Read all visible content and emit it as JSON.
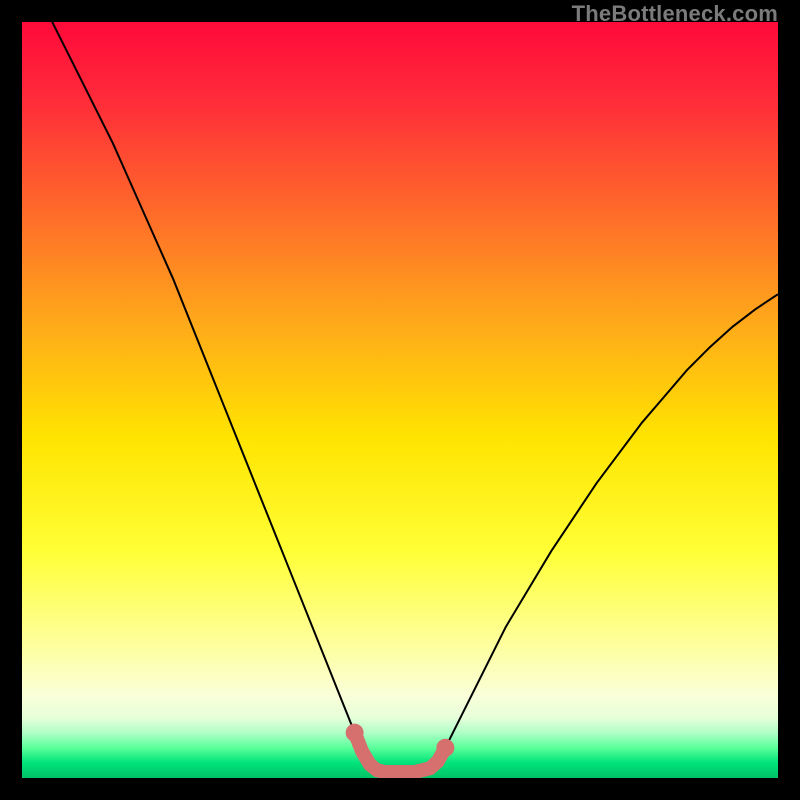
{
  "attribution": "TheBottleneck.com",
  "chart_data": {
    "type": "line",
    "title": "",
    "xlabel": "",
    "ylabel": "",
    "xlim": [
      0,
      100
    ],
    "ylim": [
      0,
      100
    ],
    "grid": false,
    "series": [
      {
        "name": "bottleneck-curve",
        "color": "#000000",
        "x": [
          4,
          6,
          8,
          10,
          12,
          14,
          16,
          18,
          20,
          22,
          24,
          26,
          28,
          30,
          32,
          34,
          36,
          38,
          40,
          42,
          44,
          45,
          46,
          47,
          48,
          50,
          52,
          54,
          55,
          56,
          58,
          60,
          62,
          64,
          67,
          70,
          73,
          76,
          79,
          82,
          85,
          88,
          91,
          94,
          97,
          100
        ],
        "y": [
          100,
          96,
          92,
          88,
          84,
          79.5,
          75,
          70.5,
          66,
          61,
          56,
          51,
          46,
          41,
          36,
          31,
          26,
          21,
          16,
          11,
          6,
          3.5,
          1.8,
          1,
          0.8,
          0.8,
          0.8,
          1.3,
          2.2,
          4,
          8,
          12,
          16,
          20,
          25,
          30,
          34.5,
          39,
          43,
          47,
          50.5,
          54,
          57,
          59.7,
          62,
          64
        ]
      },
      {
        "name": "optimal-zone-highlight",
        "color": "#d6706f",
        "x": [
          44,
          45,
          46,
          47,
          48,
          50,
          52,
          54,
          55,
          56
        ],
        "y": [
          6,
          3.5,
          1.8,
          1,
          0.8,
          0.8,
          0.8,
          1.3,
          2.2,
          4
        ]
      }
    ]
  }
}
